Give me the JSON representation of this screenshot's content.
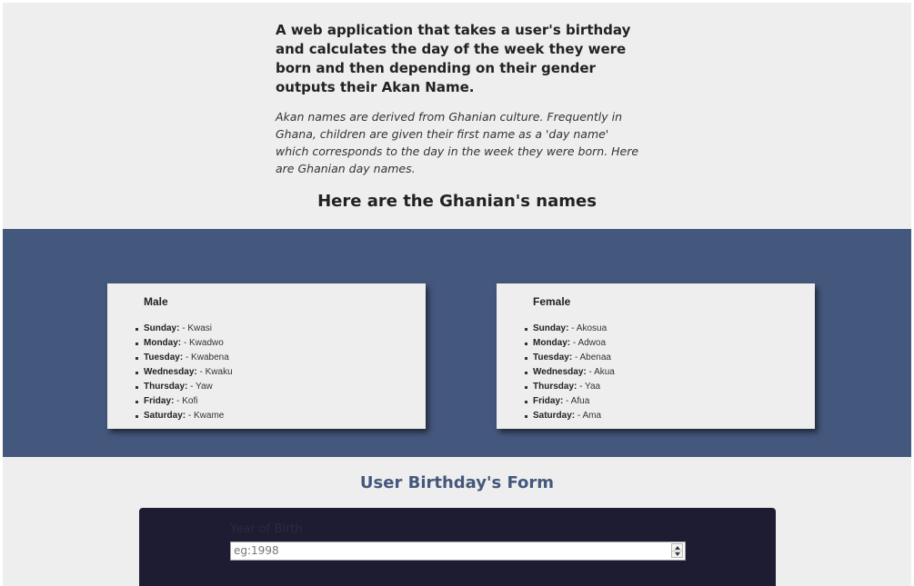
{
  "intro": {
    "heading": "A web application that takes a user's birthday and calculates the day of the week they were born and then depending on their gender outputs their Akan Name.",
    "description": "Akan names are derived from Ghanian culture. Frequently in Ghana, children are given their first name as a 'day name' which corresponds to the day in the week they were born. Here are Ghanian day names."
  },
  "names_heading": "Here are the Ghanian's names",
  "male": {
    "title": "Male",
    "items": [
      {
        "day": "Sunday:",
        "name": " - Kwasi"
      },
      {
        "day": "Monday:",
        "name": " - Kwadwo"
      },
      {
        "day": "Tuesday:",
        "name": " - Kwabena"
      },
      {
        "day": "Wednesday:",
        "name": " - Kwaku"
      },
      {
        "day": "Thursday:",
        "name": " - Yaw"
      },
      {
        "day": "Friday:",
        "name": " - Kofi"
      },
      {
        "day": "Saturday:",
        "name": " - Kwame"
      }
    ]
  },
  "female": {
    "title": "Female",
    "items": [
      {
        "day": "Sunday:",
        "name": " - Akosua"
      },
      {
        "day": "Monday:",
        "name": " - Adwoa"
      },
      {
        "day": "Tuesday:",
        "name": " - Abenaa"
      },
      {
        "day": "Wednesday:",
        "name": " - Akua"
      },
      {
        "day": "Thursday:",
        "name": " - Yaa"
      },
      {
        "day": "Friday:",
        "name": " - Afua"
      },
      {
        "day": "Saturday:",
        "name": " - Ama"
      }
    ]
  },
  "form": {
    "heading": "User Birthday's Form",
    "year_label": "Year of Birth",
    "year_placeholder": "eg:1998",
    "year_value": ""
  },
  "colors": {
    "band": "#44577d",
    "form_heading": "#44577d",
    "form_panel": "#1e1c33",
    "page_bg": "#eeeeee"
  },
  "icons": {
    "spinner": "number-spinner-icon"
  }
}
